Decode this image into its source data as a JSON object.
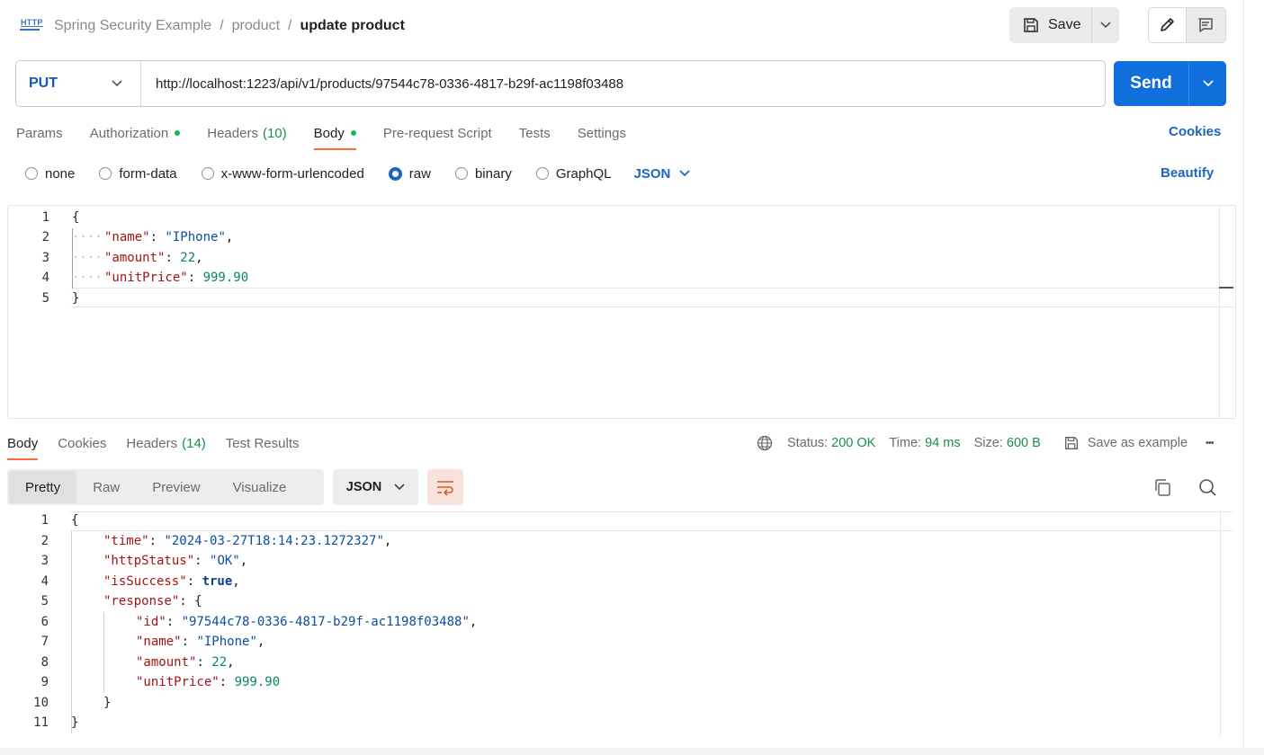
{
  "breadcrumb": {
    "collection": "Spring Security Example",
    "folder": "product",
    "request": "update product",
    "separator": "/"
  },
  "http_icon_label": "HTTP",
  "toolbar": {
    "save_label": "Save"
  },
  "request": {
    "method": "PUT",
    "url": "http://localhost:1223/api/v1/products/97544c78-0336-4817-b29f-ac1198f03488",
    "send_label": "Send"
  },
  "request_tabs": [
    {
      "label": "Params"
    },
    {
      "label": "Authorization"
    },
    {
      "label": "Headers",
      "count": "(10)"
    },
    {
      "label": "Body"
    },
    {
      "label": "Pre-request Script"
    },
    {
      "label": "Tests"
    },
    {
      "label": "Settings"
    }
  ],
  "cookies_label": "Cookies",
  "body_types": [
    {
      "label": "none"
    },
    {
      "label": "form-data"
    },
    {
      "label": "x-www-form-urlencoded"
    },
    {
      "label": "raw",
      "selected": true
    },
    {
      "label": "binary"
    },
    {
      "label": "GraphQL"
    }
  ],
  "body_format": "JSON",
  "beautify_label": "Beautify",
  "request_body_lines": [
    {
      "n": "1",
      "text": "{"
    },
    {
      "n": "2",
      "key": "\"name\"",
      "value": "\"IPhone\"",
      "vtype": "s",
      "trail": ","
    },
    {
      "n": "3",
      "key": "\"amount\"",
      "value": "22",
      "vtype": "n",
      "trail": ","
    },
    {
      "n": "4",
      "key": "\"unitPrice\"",
      "value": "999.90",
      "vtype": "n",
      "trail": ""
    },
    {
      "n": "5",
      "text": "}"
    }
  ],
  "response_tabs": [
    {
      "label": "Body"
    },
    {
      "label": "Cookies"
    },
    {
      "label": "Headers",
      "count": "(14)"
    },
    {
      "label": "Test Results"
    }
  ],
  "status": {
    "status_label": "Status:",
    "status_value": "200 OK",
    "time_label": "Time:",
    "time_value": "94 ms",
    "size_label": "Size:",
    "size_value": "600 B",
    "save_example_label": "Save as example",
    "more": "•••"
  },
  "view_tabs": [
    {
      "label": "Pretty"
    },
    {
      "label": "Raw"
    },
    {
      "label": "Preview"
    },
    {
      "label": "Visualize"
    }
  ],
  "response_format": "JSON",
  "response_body_lines": [
    {
      "n": "1",
      "indent": 0,
      "text": "{"
    },
    {
      "n": "2",
      "indent": 1,
      "key": "\"time\"",
      "value": "\"2024-03-27T18:14:23.1272327\"",
      "vtype": "s",
      "trail": ","
    },
    {
      "n": "3",
      "indent": 1,
      "key": "\"httpStatus\"",
      "value": "\"OK\"",
      "vtype": "s",
      "trail": ","
    },
    {
      "n": "4",
      "indent": 1,
      "key": "\"isSuccess\"",
      "value": "true",
      "vtype": "b",
      "trail": ","
    },
    {
      "n": "5",
      "indent": 1,
      "key": "\"response\"",
      "value": "{",
      "vtype": "p",
      "trail": ""
    },
    {
      "n": "6",
      "indent": 2,
      "key": "\"id\"",
      "value": "\"97544c78-0336-4817-b29f-ac1198f03488\"",
      "vtype": "s",
      "trail": ","
    },
    {
      "n": "7",
      "indent": 2,
      "key": "\"name\"",
      "value": "\"IPhone\"",
      "vtype": "s",
      "trail": ","
    },
    {
      "n": "8",
      "indent": 2,
      "key": "\"amount\"",
      "value": "22",
      "vtype": "n",
      "trail": ","
    },
    {
      "n": "9",
      "indent": 2,
      "key": "\"unitPrice\"",
      "value": "999.90",
      "vtype": "n",
      "trail": ""
    },
    {
      "n": "10",
      "indent": 1,
      "text": "}"
    },
    {
      "n": "11",
      "indent": 0,
      "text": "}"
    }
  ],
  "colors": {
    "accent": "#ff6c37",
    "send": "#0f6fdc",
    "link": "#1a66c0",
    "status_ok": "#1a8f4b"
  },
  "icons": {
    "save": "save-icon",
    "edit": "pencil-icon",
    "comments": "comment-icon",
    "globe": "globe-icon",
    "copy": "copy-icon",
    "search": "search-icon",
    "wrap": "wrap-lines-icon"
  }
}
